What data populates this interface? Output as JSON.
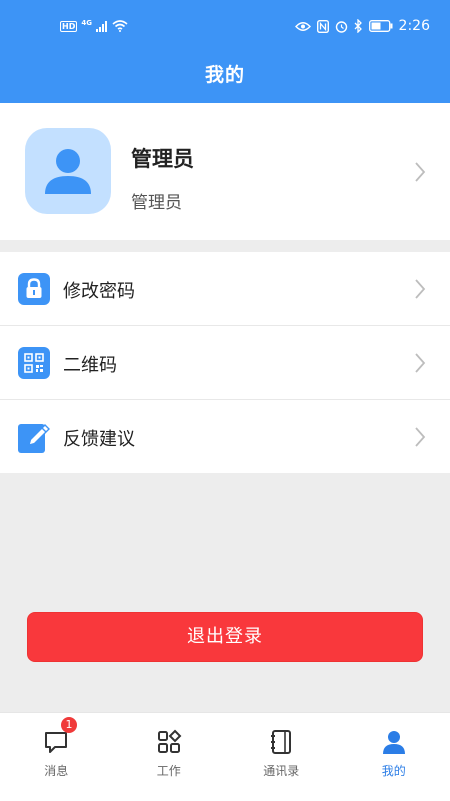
{
  "status_bar": {
    "hd": "HD",
    "network": "4G",
    "time": "2:26"
  },
  "header": {
    "title": "我的"
  },
  "profile": {
    "name": "管理员",
    "role": "管理员"
  },
  "menu": [
    {
      "label": "修改密码",
      "icon": "lock-icon"
    },
    {
      "label": "二维码",
      "icon": "qr-code-icon"
    },
    {
      "label": "反馈建议",
      "icon": "edit-icon"
    }
  ],
  "logout": {
    "label": "退出登录"
  },
  "tabbar": [
    {
      "label": "消息",
      "icon": "message-icon",
      "badge": "1",
      "active": false
    },
    {
      "label": "工作",
      "icon": "apps-icon",
      "active": false
    },
    {
      "label": "通讯录",
      "icon": "contacts-icon",
      "active": false
    },
    {
      "label": "我的",
      "icon": "user-icon",
      "active": true
    }
  ],
  "colors": {
    "primary": "#3d94f6",
    "danger": "#f9383c",
    "background": "#ededed",
    "avatar_bg": "#c3e0ff",
    "tab_active": "#2b7de6"
  }
}
